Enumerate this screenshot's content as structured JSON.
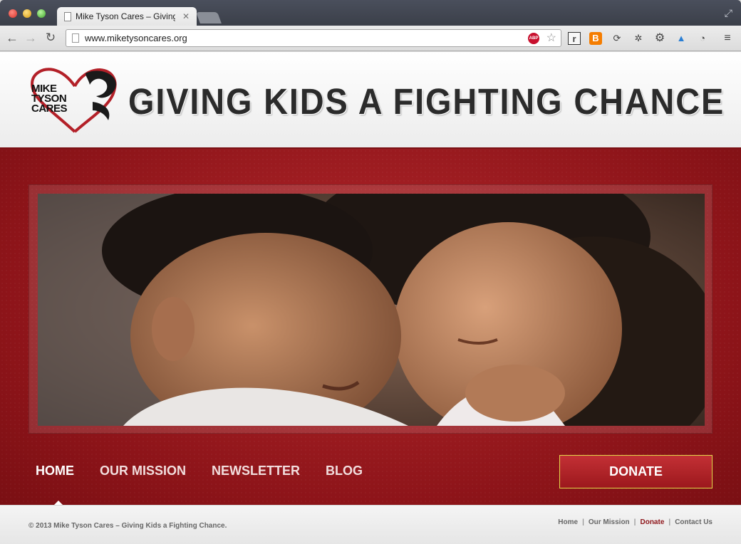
{
  "browser": {
    "tab_title": "Mike Tyson Cares – Giving",
    "tab_close": "✕",
    "url": "www.miketysoncares.org",
    "abp_label": "ABP"
  },
  "site": {
    "logo_text": [
      "MIKE",
      "TYSON",
      "CARES"
    ],
    "tagline": "GIVING KIDS A FIGHTING CHANCE",
    "accent_color": "#9c181d"
  },
  "nav": {
    "items": [
      {
        "label": "HOME"
      },
      {
        "label": "OUR MISSION"
      },
      {
        "label": "NEWSLETTER"
      },
      {
        "label": "BLOG"
      }
    ],
    "donate": "DONATE"
  },
  "footer": {
    "copyright": "© 2013 Mike Tyson Cares – Giving Kids a Fighting Chance.",
    "links": [
      {
        "label": "Home"
      },
      {
        "label": "Our Mission"
      },
      {
        "label": "Donate"
      },
      {
        "label": "Contact Us"
      }
    ]
  }
}
